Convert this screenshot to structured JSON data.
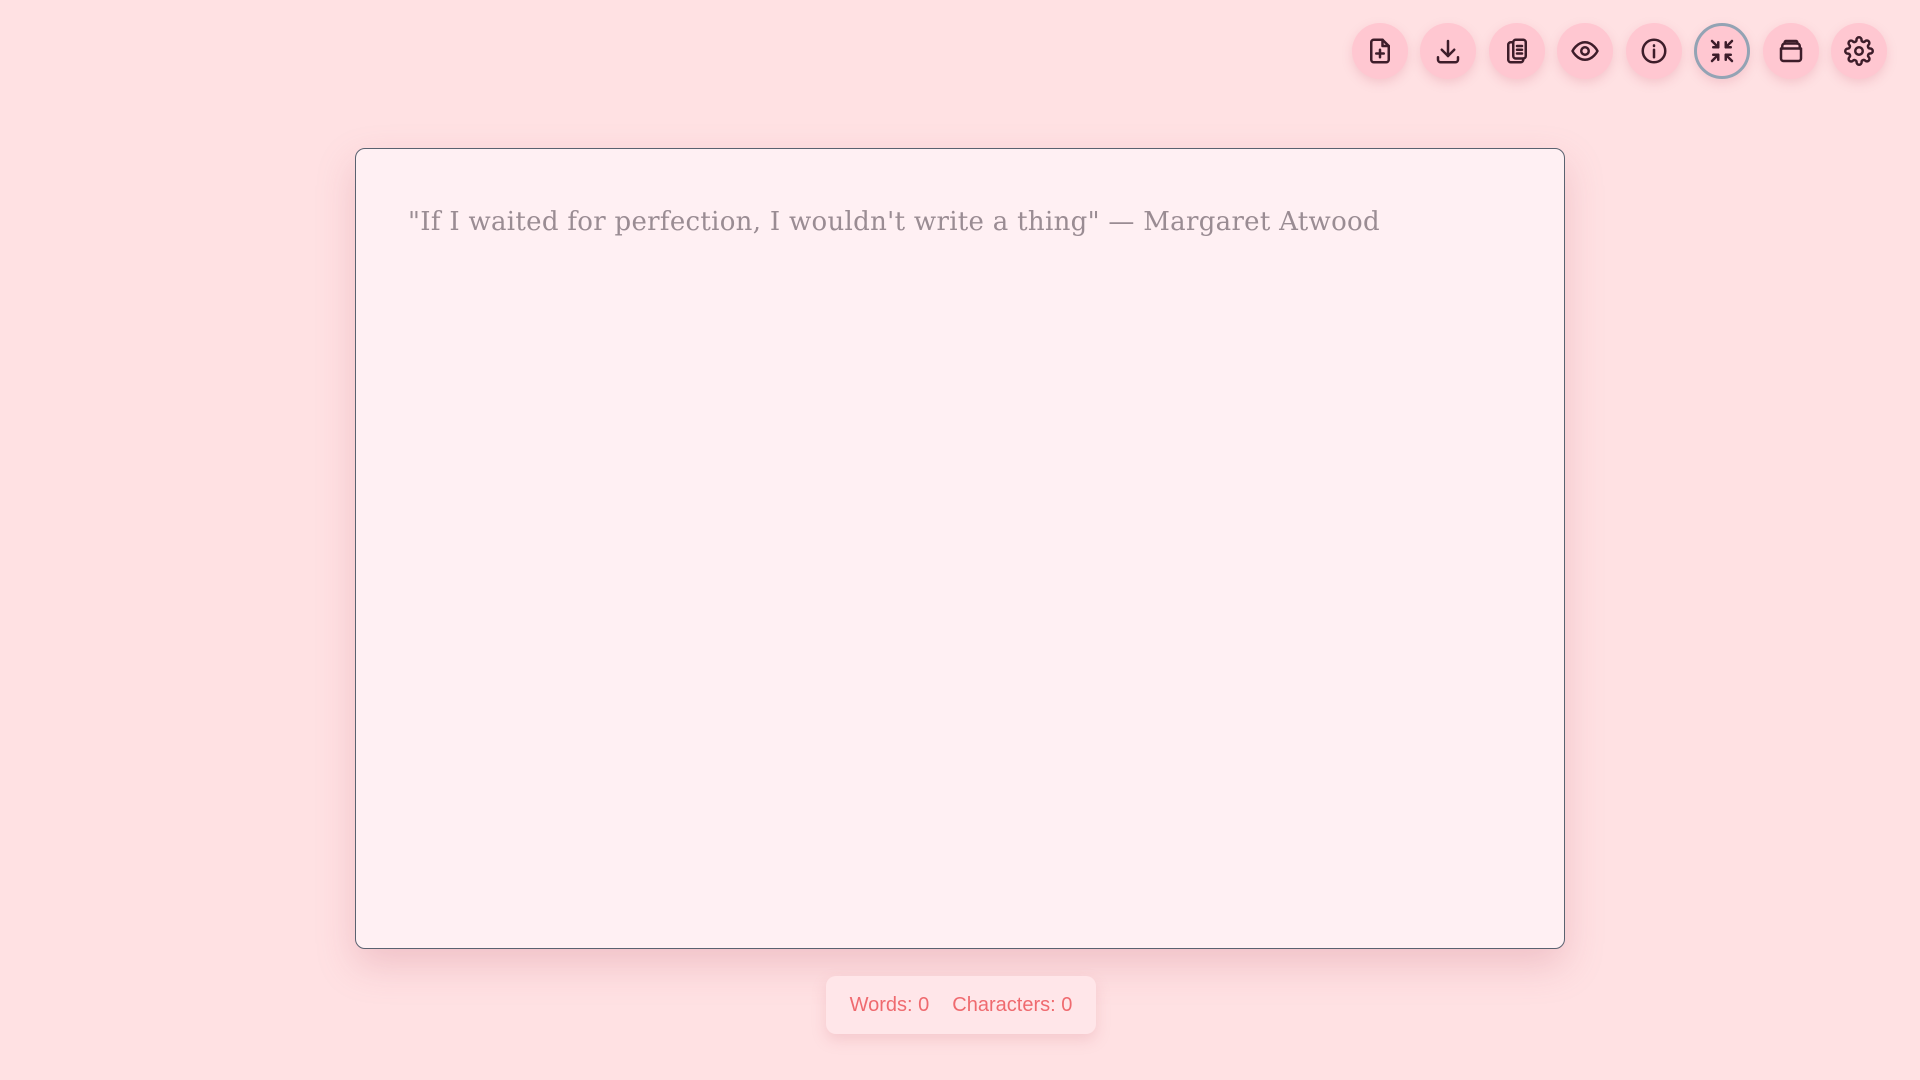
{
  "toolbar": {
    "buttons": [
      {
        "icon": "new-file-icon",
        "label": "New document"
      },
      {
        "icon": "download-icon",
        "label": "Download"
      },
      {
        "icon": "clipboard-icon",
        "label": "Copy to clipboard"
      },
      {
        "icon": "eye-icon",
        "label": "Preview"
      },
      {
        "icon": "info-icon",
        "label": "Info"
      },
      {
        "icon": "minimize-icon",
        "label": "Exit fullscreen"
      },
      {
        "icon": "folder-icon",
        "label": "Documents"
      },
      {
        "icon": "gear-icon",
        "label": "Settings"
      }
    ]
  },
  "editor": {
    "value": "",
    "placeholder": "\"If I waited for perfection, I wouldn't write a thing\" — Margaret Atwood"
  },
  "stats": {
    "words": "Words: 0",
    "characters": "Characters: 0"
  },
  "colors": {
    "background": "#ffe1e3",
    "button": "#ffc7d1",
    "editor_bg": "#fff0f3",
    "stats_text": "#ef6a6f",
    "active_ring": "#93a3b4"
  }
}
